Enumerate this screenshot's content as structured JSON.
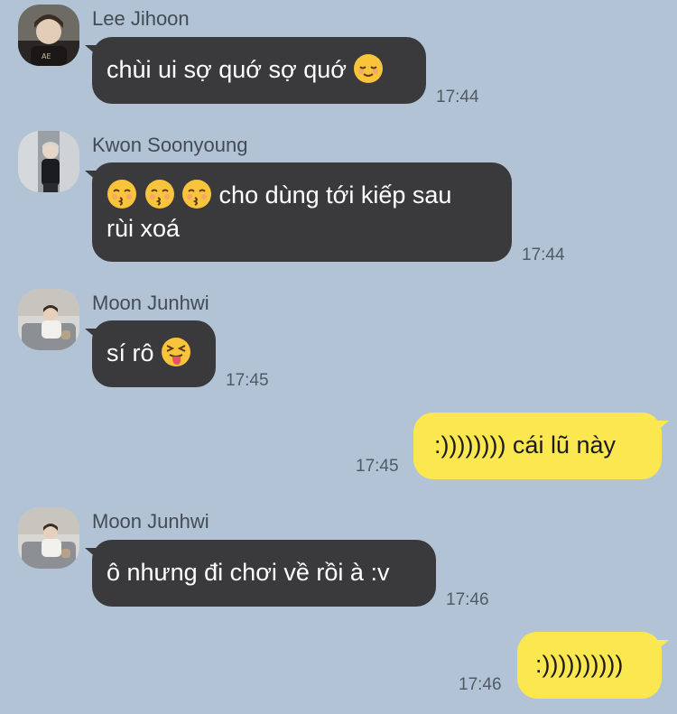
{
  "messages": [
    {
      "sender": "Lee Jihoon",
      "text": "chùi ui sợ quớ sợ quớ",
      "emoji": "relieved-face",
      "time": "17:44"
    },
    {
      "sender": "Kwon Soonyoung",
      "text_prefix_emojis": [
        "kissing-face-closed-eyes",
        "kissing-face-closed-eyes",
        "kissing-face-closed-eyes"
      ],
      "text_line1": "cho dùng tới kiếp sau",
      "text_line2": "rùi xoá",
      "time": "17:44"
    },
    {
      "sender": "Moon Junhwi",
      "text": "sí rô",
      "emoji": "squinting-tongue-face",
      "time": "17:45"
    },
    {
      "sender": "me",
      "text": ":)))))))) cái lũ này",
      "time": "17:45"
    },
    {
      "sender": "Moon Junhwi",
      "text": "ô nhưng đi chơi về rồi à :v",
      "time": "17:46"
    },
    {
      "sender": "me",
      "text": ":))))))))))",
      "time": "17:46"
    }
  ],
  "colors": {
    "background": "#b1c3d4",
    "incoming_bubble": "#3a3a3c",
    "outgoing_bubble": "#fbe850",
    "emoji_yellow": "#f7c43c"
  }
}
